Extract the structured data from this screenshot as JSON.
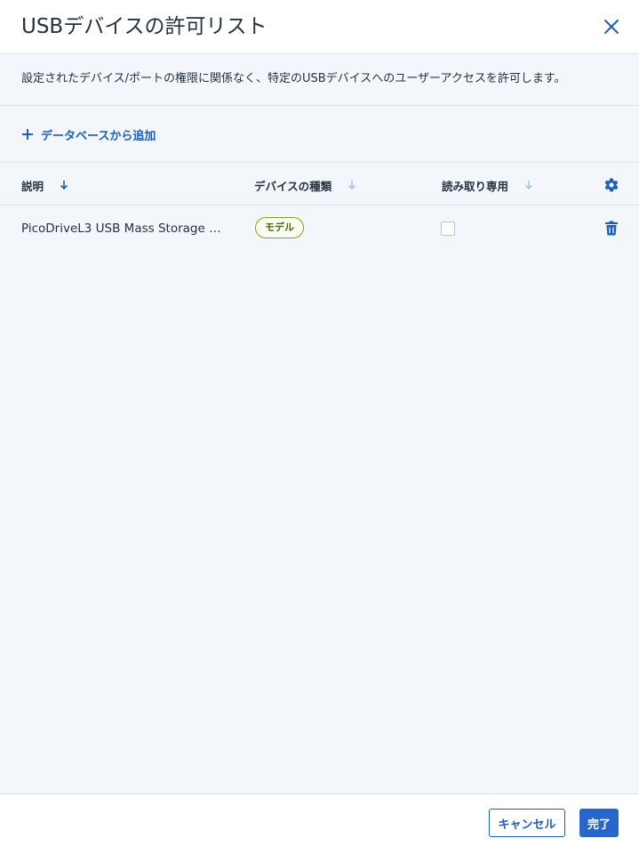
{
  "dialog": {
    "title": "USBデバイスの許可リスト",
    "description": "設定されたデバイス/ポートの権限に関係なく、特定のUSBデバイスへのユーザーアクセスを許可します。",
    "add_from_db_label": "データベースから追加"
  },
  "table": {
    "columns": {
      "description": "説明",
      "device_type": "デバイスの種類",
      "read_only": "読み取り専用"
    },
    "rows": [
      {
        "description": "PicoDriveL3 USB Mass Storage Device",
        "device_type": "モデル",
        "read_only": false
      }
    ]
  },
  "footer": {
    "cancel_label": "キャンセル",
    "done_label": "完了"
  },
  "colors": {
    "accent": "#1c5ebd",
    "badge_border": "#7aa81f",
    "body_bg": "#f3f7fc"
  },
  "icons": {
    "close": "close-icon",
    "add": "plus-icon",
    "sort": "arrow-down-icon",
    "settings": "gear-icon",
    "delete": "trash-icon"
  }
}
